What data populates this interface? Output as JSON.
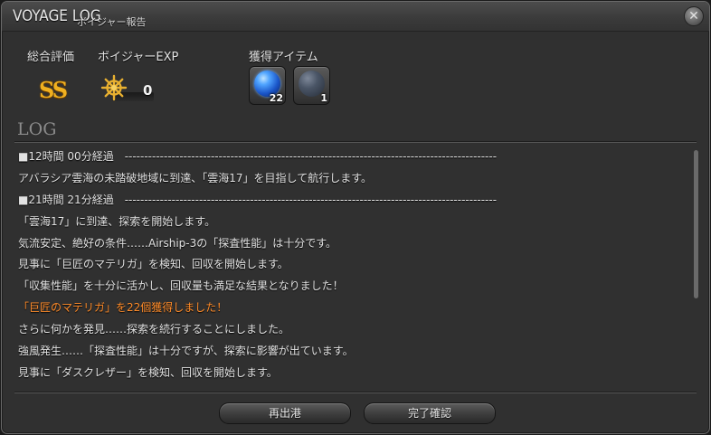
{
  "window": {
    "title": "VOYAGE LOG",
    "subtitle": "ボイジャー報告",
    "close_icon": "close-icon"
  },
  "summary": {
    "rating_label": "総合評価",
    "rating_value": "SS",
    "exp_label": "ボイジャーEXP",
    "exp_value": "0",
    "exp_icon": "ship-wheel-icon",
    "items_label": "獲得アイテム",
    "items": [
      {
        "icon": "blue-gem-orb-icon",
        "count": "22",
        "color": "#2f7fe0"
      },
      {
        "icon": "dark-stone-orb-icon",
        "count": "1",
        "color": "#4a5566"
      }
    ]
  },
  "log": {
    "heading": "LOG",
    "lines": [
      {
        "text": "■12時間 00分経過　-----------------------------------------------------------------------------------------------",
        "highlight": false
      },
      {
        "text": "アバラシア雲海の未踏破地域に到達、「雲海17」を目指して航行します。",
        "highlight": false
      },
      {
        "text": "■21時間 21分経過　-----------------------------------------------------------------------------------------------",
        "highlight": false
      },
      {
        "text": "「雲海17」に到達、探索を開始します。",
        "highlight": false
      },
      {
        "text": "気流安定、絶好の条件……Airship-3の「探査性能」は十分です。",
        "highlight": false
      },
      {
        "text": "見事に「巨匠のマテリガ」を検知、回収を開始します。",
        "highlight": false
      },
      {
        "text": "「収集性能」を十分に活かし、回収量も満足な結果となりました！",
        "highlight": false
      },
      {
        "text": "「巨匠のマテリガ」を22個獲得しました！",
        "highlight": true
      },
      {
        "text": "さらに何かを発見……探索を続行することにしました。",
        "highlight": false
      },
      {
        "text": "強風発生……「探査性能」は十分ですが、探索に影響が出ています。",
        "highlight": false
      },
      {
        "text": "見事に「ダスクレザー」を検知、回収を開始します。",
        "highlight": false
      }
    ]
  },
  "buttons": {
    "redeploy": "再出港",
    "confirm": "完了確認"
  },
  "colors": {
    "highlight": "#ff8c2a",
    "rating": "#f0b020",
    "panel": "#303030"
  }
}
